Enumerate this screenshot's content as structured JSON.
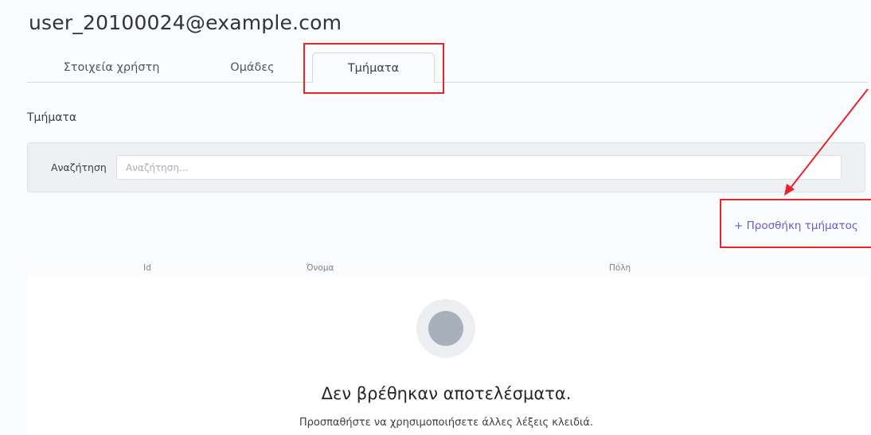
{
  "header": {
    "user_email": "user_20100024@example.com"
  },
  "tabs": [
    {
      "label": "Στοιχεία χρήστη"
    },
    {
      "label": "Ομάδες"
    },
    {
      "label": "Τμήματα"
    }
  ],
  "section": {
    "title": "Τμήματα"
  },
  "search": {
    "label": "Αναζήτηση",
    "placeholder": "Αναζήτηση..."
  },
  "actions": {
    "add_department": "+ Προσθήκη τμήματος"
  },
  "table": {
    "columns": [
      "Id",
      "Όνομα",
      "Πόλη"
    ]
  },
  "empty_state": {
    "icon": "empty-circle-icon",
    "title": "Δεν βρέθηκαν αποτελέσματα.",
    "subtitle": "Προσπαθήστε να χρησιμοποιήσετε άλλες λέξεις κλειδιά."
  },
  "colors": {
    "accent": "#6d5bd0",
    "annotation": "#e8232a"
  }
}
